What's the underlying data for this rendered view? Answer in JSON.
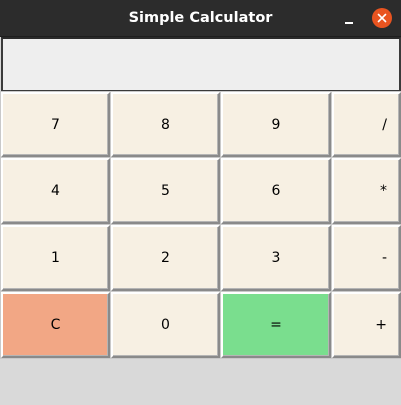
{
  "window": {
    "title": "Simple Calculator"
  },
  "display": {
    "value": ""
  },
  "keypad": {
    "row1": [
      "7",
      "8",
      "9",
      "/"
    ],
    "row2": [
      "4",
      "5",
      "6",
      "*"
    ],
    "row3": [
      "1",
      "2",
      "3",
      "-"
    ],
    "row4": [
      "C",
      "0",
      "=",
      "+"
    ]
  },
  "colors": {
    "titlebar": "#2c2c2c",
    "close_button": "#e95420",
    "key_default": "#f7f0e3",
    "key_clear": "#f2a785",
    "key_equals": "#7ade8e",
    "display_bg": "#eeeeee",
    "window_bg": "#d9d9d9"
  },
  "icons": {
    "minimize": "minimize-icon",
    "close": "close-icon"
  }
}
